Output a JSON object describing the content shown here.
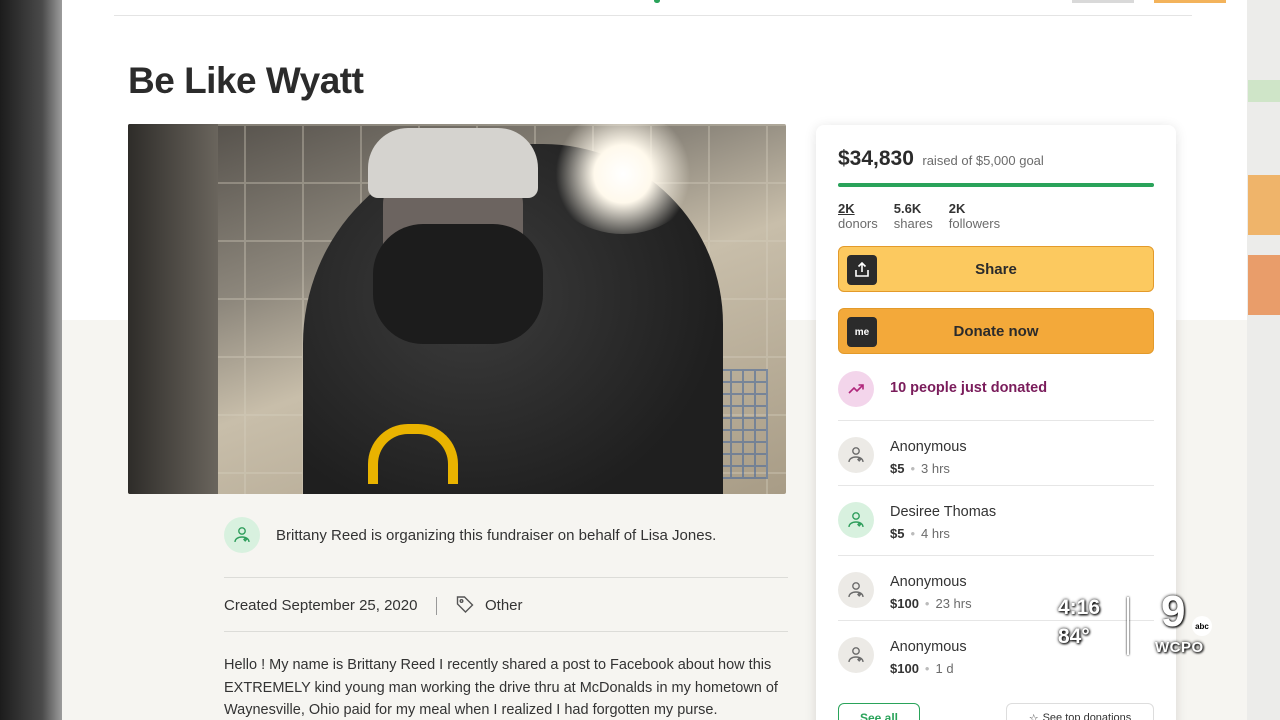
{
  "campaign": {
    "title": "Be Like Wyatt",
    "organizer_text": "Brittany Reed is organizing this fundraiser on behalf of Lisa Jones.",
    "created": "Created September 25, 2020",
    "category": "Other",
    "story_lines": [
      "Hello ! My name is Brittany Reed I recently shared a post to Facebook about how this",
      "EXTREMELY kind young man working the drive thru at McDonalds in my hometown of",
      "Waynesville, Ohio paid for my meal when I realized I had forgotten my purse."
    ]
  },
  "sidebar": {
    "amount_raised": "$34,830",
    "goal_text": "raised of $5,000 goal",
    "progress_fraction": 1.0,
    "stats": [
      {
        "value": "2K",
        "label": "donors"
      },
      {
        "value": "5.6K",
        "label": "shares"
      },
      {
        "value": "2K",
        "label": "followers"
      }
    ],
    "share_label": "Share",
    "donate_label": "Donate now",
    "donate_icon_text": "me",
    "just_donated": "10 people just donated",
    "donations": [
      {
        "name": "Anonymous",
        "amount": "$5",
        "time": "3 hrs",
        "avatar": "gray"
      },
      {
        "name": "Desiree Thomas",
        "amount": "$5",
        "time": "4 hrs",
        "avatar": "green"
      },
      {
        "name": "Anonymous",
        "amount": "$100",
        "time": "23 hrs",
        "avatar": "gray"
      },
      {
        "name": "Anonymous",
        "amount": "$100",
        "time": "1 d",
        "avatar": "gray"
      }
    ],
    "see_all_label": "See all",
    "see_top_label": "See top donations"
  },
  "tv_overlay": {
    "time": "4:16",
    "temperature": "84°",
    "channel": "9",
    "network": "abc",
    "callsign": "WCPO"
  },
  "colors": {
    "brand_green": "#2aa35a",
    "share_yellow": "#fcc95f",
    "donate_orange": "#f3a93a",
    "trend_purple": "#7a1c5b"
  },
  "icons": {
    "share": "upload-icon",
    "donate": "gofundme-icon",
    "category": "tag-icon",
    "trend": "trending-up-icon",
    "donor": "heart-hand-icon"
  }
}
